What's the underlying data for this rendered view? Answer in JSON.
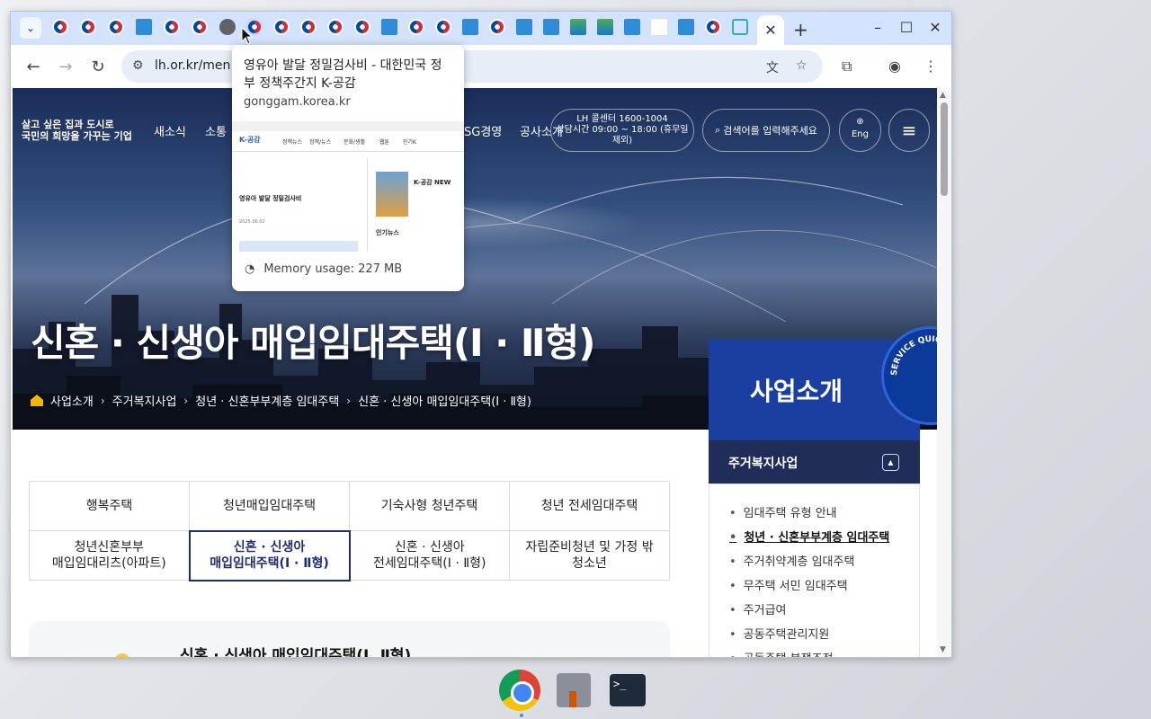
{
  "browser": {
    "url": "lh.or.kr/men",
    "tab_close_glyph": "✕",
    "new_tab_glyph": "+",
    "tab_dropdown_glyph": "⌄"
  },
  "tooltip": {
    "title": "영유아 발달 정밀검사비 - 대한민국 정부 정책주간지 K-공감",
    "host": "gonggam.korea.kr",
    "memory": "Memory usage: 227 MB",
    "preview": {
      "logo": "K-공감",
      "nav": [
        "정책뉴스",
        "정책/뉴스",
        "문화/생활",
        "웹툰",
        "인기K"
      ],
      "headline": "영유아 발달 정밀검사비",
      "side_label": "K-공감 NEW",
      "news_label": "인기뉴스",
      "date": "2025.06.02"
    }
  },
  "site": {
    "logo_line1": "살고 싶은 집과 도시로",
    "logo_line2": "국민의 희망을 가꾸는 기업",
    "gnb": [
      "새소식",
      "소통",
      "SG경영",
      "공사소개"
    ],
    "callcenter_line1": "LH 콜센터 1600-1004",
    "callcenter_line2": "상담시간 09:00 ~ 18:00 (휴무일 제외)",
    "search_placeholder": "검색어를 입력해주세요",
    "eng_label": "Eng",
    "hero_title": "신혼 · 신생아 매입임대주택(Ⅰ · Ⅱ형)",
    "breadcrumb": [
      "사업소개",
      "주거복지사업",
      "청년 · 신혼부부계층 임대주택",
      "신혼 · 신생아 매입임대주택(Ⅰ · Ⅱ형)"
    ]
  },
  "side_panel": {
    "title": "사업소개",
    "quick_label": "SERVICE QUICK MENU",
    "sub_title": "주거복지사업",
    "items": [
      {
        "label": "임대주택 유형 안내",
        "active": false
      },
      {
        "label": "청년 · 신혼부부계층 임대주택",
        "active": true
      },
      {
        "label": "주거취약계층 임대주택",
        "active": false
      },
      {
        "label": "무주택 서민 임대주택",
        "active": false
      },
      {
        "label": "주거급여",
        "active": false
      },
      {
        "label": "공동주택관리지원",
        "active": false
      },
      {
        "label": "공동주택 분쟁조정",
        "active": false
      }
    ]
  },
  "tabs": {
    "row1": [
      "행복주택",
      "청년매입임대주택",
      "기숙사형 청년주택",
      "청년 전세임대주택"
    ],
    "row2": [
      {
        "line1": "청년신혼부부",
        "line2": "매입임대리츠(아파트)"
      },
      {
        "line1": "신혼 · 신생아",
        "line2": "매입임대주택(Ⅰ · Ⅱ형)"
      },
      {
        "line1": "신혼 · 신생아",
        "line2": "전세임대주택(Ⅰ · Ⅱ형)"
      },
      {
        "line1": "자립준비청년 및 가정 밖",
        "line2": "청소년"
      }
    ]
  },
  "content": {
    "title": "신혼 · 신생아 매입임대주택(Ⅰ, Ⅱ형)"
  }
}
